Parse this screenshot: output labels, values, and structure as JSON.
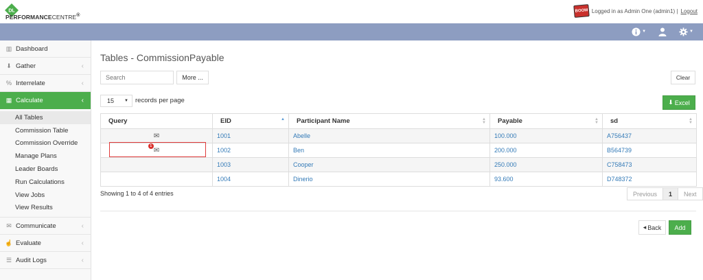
{
  "header": {
    "logo_mark": "DL",
    "logo_text_bold": "PERFORMANCE",
    "logo_text_light": "CENTRE",
    "logo_trademark": "®",
    "avatar_label": "BOOM",
    "logged_in_text": "Logged in as Admin One (admin1) |",
    "logout_label": "Logout"
  },
  "nav": {
    "icons": [
      "info-icon",
      "user-icon",
      "gear-icon"
    ],
    "navbar_color": "#8d9dc1"
  },
  "sidebar": {
    "items": [
      {
        "label": "Dashboard",
        "icon": "bar-chart-icon",
        "chevron": false
      },
      {
        "label": "Gather",
        "icon": "download-icon",
        "chevron": true
      },
      {
        "label": "Interrelate",
        "icon": "link-icon",
        "chevron": true
      },
      {
        "label": "Calculate",
        "icon": "table-icon",
        "chevron": true,
        "active": true
      }
    ],
    "sub_items": [
      "All Tables",
      "Commission Table",
      "Commission Override",
      "Manage Plans",
      "Leader Boards",
      "Run Calculations",
      "View Jobs",
      "View Results"
    ],
    "items_after": [
      {
        "label": "Communicate",
        "icon": "comments-icon",
        "chevron": true
      },
      {
        "label": "Evaluate",
        "icon": "thumbs-up-icon",
        "chevron": true
      },
      {
        "label": "Audit Logs",
        "icon": "list-icon",
        "chevron": true
      }
    ],
    "active_color": "#4cae4c"
  },
  "main": {
    "title": "Tables - CommissionPayable",
    "search_placeholder": "Search",
    "more_label": "More ...",
    "clear_label": "Clear",
    "page_size": "15",
    "records_label": "records per page",
    "excel_label": "Excel",
    "columns": [
      "Query",
      "EID",
      "Participant Name",
      "Payable",
      "sd"
    ],
    "rows": [
      {
        "eid": "1001",
        "name": "Abelle",
        "payable": "100.000",
        "sd": "A756437",
        "has_query": true,
        "badge": ""
      },
      {
        "eid": "1002",
        "name": "Ben",
        "payable": "200.000",
        "sd": "B564739",
        "has_query": true,
        "badge": "1"
      },
      {
        "eid": "1003",
        "name": "Cooper",
        "payable": "250.000",
        "sd": "C758473",
        "has_query": false,
        "badge": ""
      },
      {
        "eid": "1004",
        "name": "Dinerio",
        "payable": "93.600",
        "sd": "D748372",
        "has_query": false,
        "badge": ""
      }
    ],
    "showing": "Showing 1 to 4 of 4 entries",
    "pager": {
      "previous": "Previous",
      "current": "1",
      "next": "Next"
    },
    "back_label": "Back",
    "add_label": "Add",
    "accent_color": "#4cae4c",
    "link_color": "#337ab7",
    "highlight_color": "#e03a3a"
  }
}
